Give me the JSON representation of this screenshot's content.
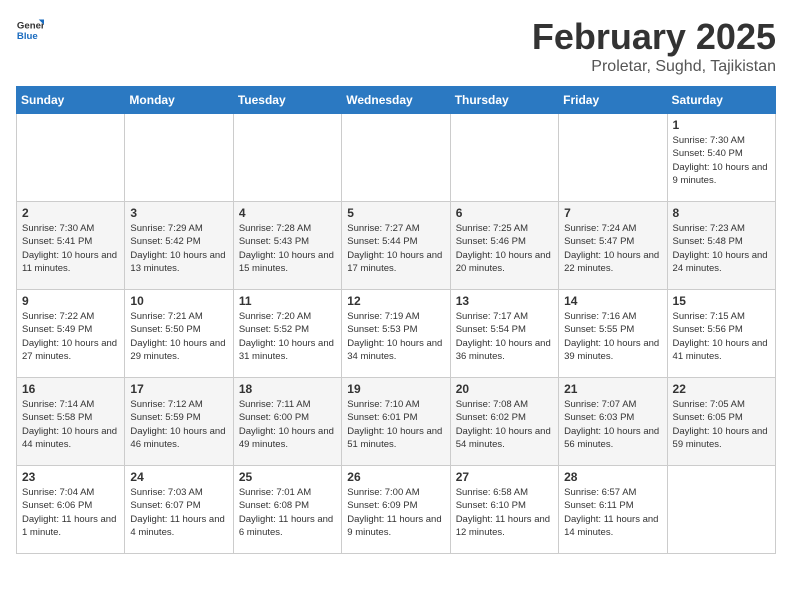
{
  "header": {
    "logo_general": "General",
    "logo_blue": "Blue",
    "title": "February 2025",
    "subtitle": "Proletar, Sughd, Tajikistan"
  },
  "weekdays": [
    "Sunday",
    "Monday",
    "Tuesday",
    "Wednesday",
    "Thursday",
    "Friday",
    "Saturday"
  ],
  "weeks": [
    [
      null,
      null,
      null,
      null,
      null,
      null,
      {
        "day": "1",
        "sunrise": "7:30 AM",
        "sunset": "5:40 PM",
        "daylight": "10 hours and 9 minutes."
      }
    ],
    [
      {
        "day": "2",
        "sunrise": "7:30 AM",
        "sunset": "5:41 PM",
        "daylight": "10 hours and 11 minutes."
      },
      {
        "day": "3",
        "sunrise": "7:29 AM",
        "sunset": "5:42 PM",
        "daylight": "10 hours and 13 minutes."
      },
      {
        "day": "4",
        "sunrise": "7:28 AM",
        "sunset": "5:43 PM",
        "daylight": "10 hours and 15 minutes."
      },
      {
        "day": "5",
        "sunrise": "7:27 AM",
        "sunset": "5:44 PM",
        "daylight": "10 hours and 17 minutes."
      },
      {
        "day": "6",
        "sunrise": "7:25 AM",
        "sunset": "5:46 PM",
        "daylight": "10 hours and 20 minutes."
      },
      {
        "day": "7",
        "sunrise": "7:24 AM",
        "sunset": "5:47 PM",
        "daylight": "10 hours and 22 minutes."
      },
      {
        "day": "8",
        "sunrise": "7:23 AM",
        "sunset": "5:48 PM",
        "daylight": "10 hours and 24 minutes."
      }
    ],
    [
      {
        "day": "9",
        "sunrise": "7:22 AM",
        "sunset": "5:49 PM",
        "daylight": "10 hours and 27 minutes."
      },
      {
        "day": "10",
        "sunrise": "7:21 AM",
        "sunset": "5:50 PM",
        "daylight": "10 hours and 29 minutes."
      },
      {
        "day": "11",
        "sunrise": "7:20 AM",
        "sunset": "5:52 PM",
        "daylight": "10 hours and 31 minutes."
      },
      {
        "day": "12",
        "sunrise": "7:19 AM",
        "sunset": "5:53 PM",
        "daylight": "10 hours and 34 minutes."
      },
      {
        "day": "13",
        "sunrise": "7:17 AM",
        "sunset": "5:54 PM",
        "daylight": "10 hours and 36 minutes."
      },
      {
        "day": "14",
        "sunrise": "7:16 AM",
        "sunset": "5:55 PM",
        "daylight": "10 hours and 39 minutes."
      },
      {
        "day": "15",
        "sunrise": "7:15 AM",
        "sunset": "5:56 PM",
        "daylight": "10 hours and 41 minutes."
      }
    ],
    [
      {
        "day": "16",
        "sunrise": "7:14 AM",
        "sunset": "5:58 PM",
        "daylight": "10 hours and 44 minutes."
      },
      {
        "day": "17",
        "sunrise": "7:12 AM",
        "sunset": "5:59 PM",
        "daylight": "10 hours and 46 minutes."
      },
      {
        "day": "18",
        "sunrise": "7:11 AM",
        "sunset": "6:00 PM",
        "daylight": "10 hours and 49 minutes."
      },
      {
        "day": "19",
        "sunrise": "7:10 AM",
        "sunset": "6:01 PM",
        "daylight": "10 hours and 51 minutes."
      },
      {
        "day": "20",
        "sunrise": "7:08 AM",
        "sunset": "6:02 PM",
        "daylight": "10 hours and 54 minutes."
      },
      {
        "day": "21",
        "sunrise": "7:07 AM",
        "sunset": "6:03 PM",
        "daylight": "10 hours and 56 minutes."
      },
      {
        "day": "22",
        "sunrise": "7:05 AM",
        "sunset": "6:05 PM",
        "daylight": "10 hours and 59 minutes."
      }
    ],
    [
      {
        "day": "23",
        "sunrise": "7:04 AM",
        "sunset": "6:06 PM",
        "daylight": "11 hours and 1 minute."
      },
      {
        "day": "24",
        "sunrise": "7:03 AM",
        "sunset": "6:07 PM",
        "daylight": "11 hours and 4 minutes."
      },
      {
        "day": "25",
        "sunrise": "7:01 AM",
        "sunset": "6:08 PM",
        "daylight": "11 hours and 6 minutes."
      },
      {
        "day": "26",
        "sunrise": "7:00 AM",
        "sunset": "6:09 PM",
        "daylight": "11 hours and 9 minutes."
      },
      {
        "day": "27",
        "sunrise": "6:58 AM",
        "sunset": "6:10 PM",
        "daylight": "11 hours and 12 minutes."
      },
      {
        "day": "28",
        "sunrise": "6:57 AM",
        "sunset": "6:11 PM",
        "daylight": "11 hours and 14 minutes."
      },
      null
    ]
  ]
}
